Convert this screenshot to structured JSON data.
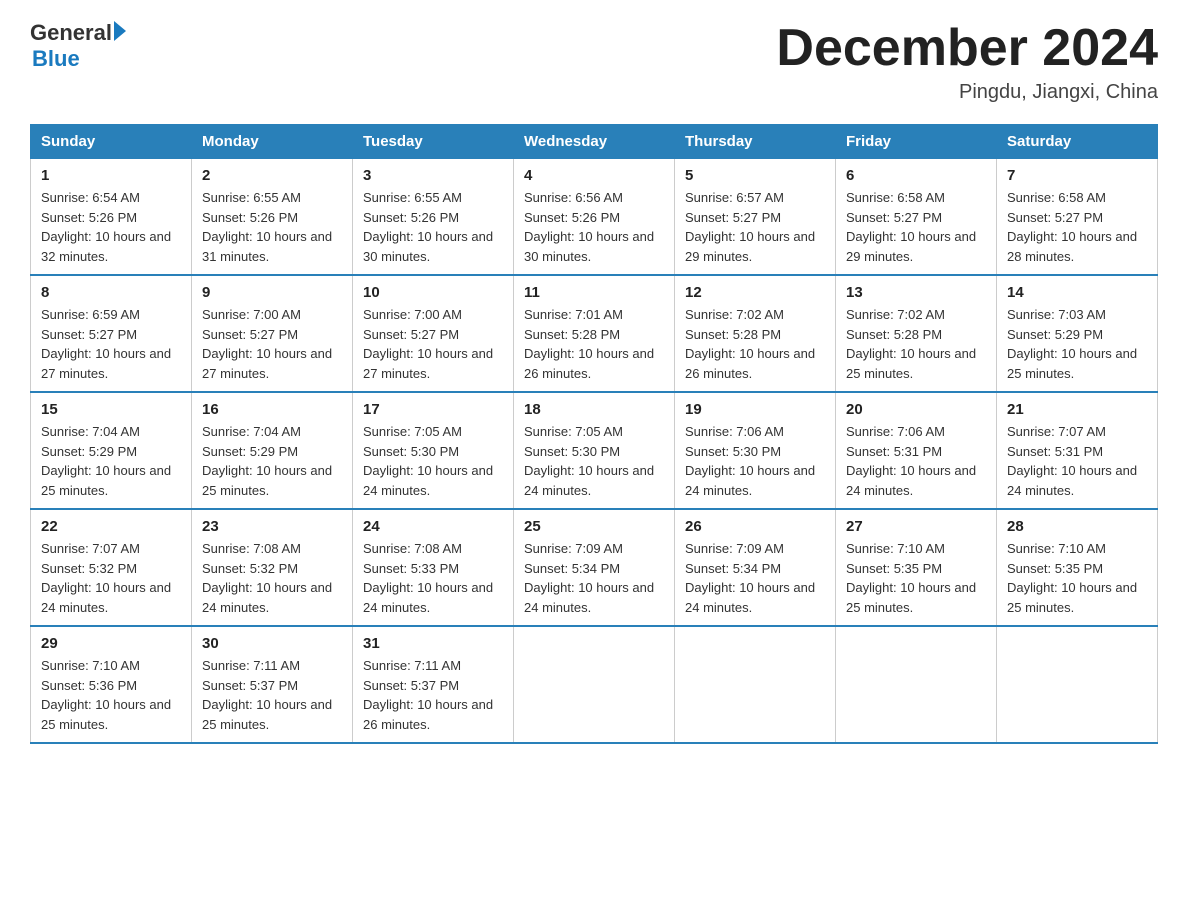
{
  "header": {
    "logo_general": "General",
    "logo_blue": "Blue",
    "title": "December 2024",
    "location": "Pingdu, Jiangxi, China"
  },
  "columns": [
    "Sunday",
    "Monday",
    "Tuesday",
    "Wednesday",
    "Thursday",
    "Friday",
    "Saturday"
  ],
  "weeks": [
    [
      {
        "day": "1",
        "sunrise": "Sunrise: 6:54 AM",
        "sunset": "Sunset: 5:26 PM",
        "daylight": "Daylight: 10 hours and 32 minutes."
      },
      {
        "day": "2",
        "sunrise": "Sunrise: 6:55 AM",
        "sunset": "Sunset: 5:26 PM",
        "daylight": "Daylight: 10 hours and 31 minutes."
      },
      {
        "day": "3",
        "sunrise": "Sunrise: 6:55 AM",
        "sunset": "Sunset: 5:26 PM",
        "daylight": "Daylight: 10 hours and 30 minutes."
      },
      {
        "day": "4",
        "sunrise": "Sunrise: 6:56 AM",
        "sunset": "Sunset: 5:26 PM",
        "daylight": "Daylight: 10 hours and 30 minutes."
      },
      {
        "day": "5",
        "sunrise": "Sunrise: 6:57 AM",
        "sunset": "Sunset: 5:27 PM",
        "daylight": "Daylight: 10 hours and 29 minutes."
      },
      {
        "day": "6",
        "sunrise": "Sunrise: 6:58 AM",
        "sunset": "Sunset: 5:27 PM",
        "daylight": "Daylight: 10 hours and 29 minutes."
      },
      {
        "day": "7",
        "sunrise": "Sunrise: 6:58 AM",
        "sunset": "Sunset: 5:27 PM",
        "daylight": "Daylight: 10 hours and 28 minutes."
      }
    ],
    [
      {
        "day": "8",
        "sunrise": "Sunrise: 6:59 AM",
        "sunset": "Sunset: 5:27 PM",
        "daylight": "Daylight: 10 hours and 27 minutes."
      },
      {
        "day": "9",
        "sunrise": "Sunrise: 7:00 AM",
        "sunset": "Sunset: 5:27 PM",
        "daylight": "Daylight: 10 hours and 27 minutes."
      },
      {
        "day": "10",
        "sunrise": "Sunrise: 7:00 AM",
        "sunset": "Sunset: 5:27 PM",
        "daylight": "Daylight: 10 hours and 27 minutes."
      },
      {
        "day": "11",
        "sunrise": "Sunrise: 7:01 AM",
        "sunset": "Sunset: 5:28 PM",
        "daylight": "Daylight: 10 hours and 26 minutes."
      },
      {
        "day": "12",
        "sunrise": "Sunrise: 7:02 AM",
        "sunset": "Sunset: 5:28 PM",
        "daylight": "Daylight: 10 hours and 26 minutes."
      },
      {
        "day": "13",
        "sunrise": "Sunrise: 7:02 AM",
        "sunset": "Sunset: 5:28 PM",
        "daylight": "Daylight: 10 hours and 25 minutes."
      },
      {
        "day": "14",
        "sunrise": "Sunrise: 7:03 AM",
        "sunset": "Sunset: 5:29 PM",
        "daylight": "Daylight: 10 hours and 25 minutes."
      }
    ],
    [
      {
        "day": "15",
        "sunrise": "Sunrise: 7:04 AM",
        "sunset": "Sunset: 5:29 PM",
        "daylight": "Daylight: 10 hours and 25 minutes."
      },
      {
        "day": "16",
        "sunrise": "Sunrise: 7:04 AM",
        "sunset": "Sunset: 5:29 PM",
        "daylight": "Daylight: 10 hours and 25 minutes."
      },
      {
        "day": "17",
        "sunrise": "Sunrise: 7:05 AM",
        "sunset": "Sunset: 5:30 PM",
        "daylight": "Daylight: 10 hours and 24 minutes."
      },
      {
        "day": "18",
        "sunrise": "Sunrise: 7:05 AM",
        "sunset": "Sunset: 5:30 PM",
        "daylight": "Daylight: 10 hours and 24 minutes."
      },
      {
        "day": "19",
        "sunrise": "Sunrise: 7:06 AM",
        "sunset": "Sunset: 5:30 PM",
        "daylight": "Daylight: 10 hours and 24 minutes."
      },
      {
        "day": "20",
        "sunrise": "Sunrise: 7:06 AM",
        "sunset": "Sunset: 5:31 PM",
        "daylight": "Daylight: 10 hours and 24 minutes."
      },
      {
        "day": "21",
        "sunrise": "Sunrise: 7:07 AM",
        "sunset": "Sunset: 5:31 PM",
        "daylight": "Daylight: 10 hours and 24 minutes."
      }
    ],
    [
      {
        "day": "22",
        "sunrise": "Sunrise: 7:07 AM",
        "sunset": "Sunset: 5:32 PM",
        "daylight": "Daylight: 10 hours and 24 minutes."
      },
      {
        "day": "23",
        "sunrise": "Sunrise: 7:08 AM",
        "sunset": "Sunset: 5:32 PM",
        "daylight": "Daylight: 10 hours and 24 minutes."
      },
      {
        "day": "24",
        "sunrise": "Sunrise: 7:08 AM",
        "sunset": "Sunset: 5:33 PM",
        "daylight": "Daylight: 10 hours and 24 minutes."
      },
      {
        "day": "25",
        "sunrise": "Sunrise: 7:09 AM",
        "sunset": "Sunset: 5:34 PM",
        "daylight": "Daylight: 10 hours and 24 minutes."
      },
      {
        "day": "26",
        "sunrise": "Sunrise: 7:09 AM",
        "sunset": "Sunset: 5:34 PM",
        "daylight": "Daylight: 10 hours and 24 minutes."
      },
      {
        "day": "27",
        "sunrise": "Sunrise: 7:10 AM",
        "sunset": "Sunset: 5:35 PM",
        "daylight": "Daylight: 10 hours and 25 minutes."
      },
      {
        "day": "28",
        "sunrise": "Sunrise: 7:10 AM",
        "sunset": "Sunset: 5:35 PM",
        "daylight": "Daylight: 10 hours and 25 minutes."
      }
    ],
    [
      {
        "day": "29",
        "sunrise": "Sunrise: 7:10 AM",
        "sunset": "Sunset: 5:36 PM",
        "daylight": "Daylight: 10 hours and 25 minutes."
      },
      {
        "day": "30",
        "sunrise": "Sunrise: 7:11 AM",
        "sunset": "Sunset: 5:37 PM",
        "daylight": "Daylight: 10 hours and 25 minutes."
      },
      {
        "day": "31",
        "sunrise": "Sunrise: 7:11 AM",
        "sunset": "Sunset: 5:37 PM",
        "daylight": "Daylight: 10 hours and 26 minutes."
      },
      null,
      null,
      null,
      null
    ]
  ]
}
